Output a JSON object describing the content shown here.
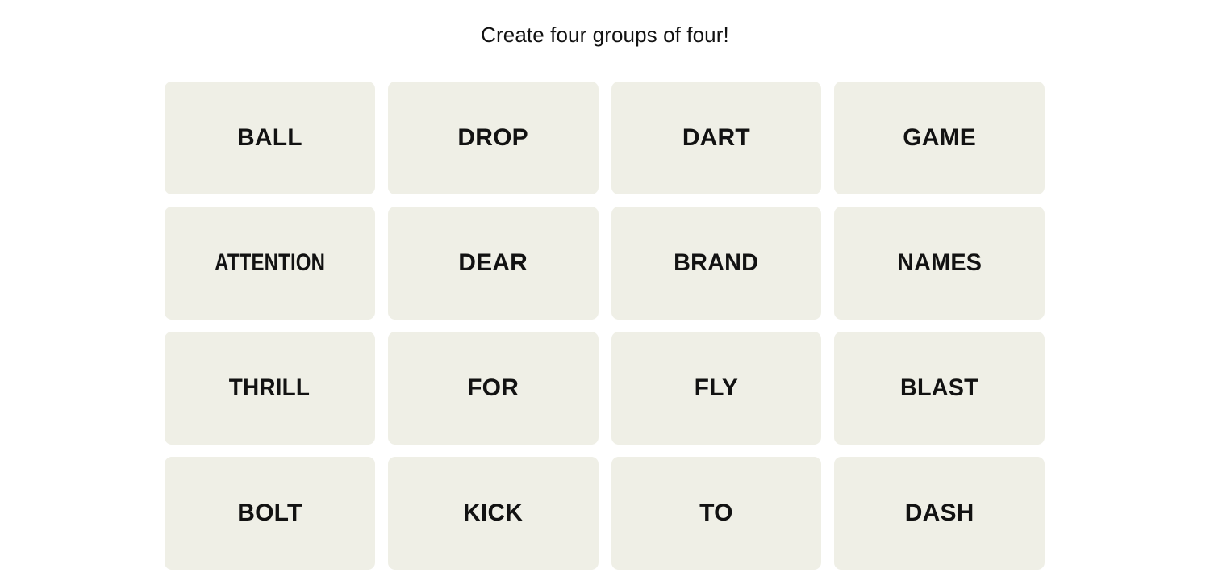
{
  "page": {
    "background_color": "#ffffff",
    "instruction": "Create four groups of four!"
  },
  "board": {
    "rows": 4,
    "columns": 4,
    "tile_background_color": "#efefe6",
    "tile_text_color": "#121212",
    "tiles": [
      {
        "label": "BALL"
      },
      {
        "label": "DROP"
      },
      {
        "label": "DART"
      },
      {
        "label": "GAME"
      },
      {
        "label": "ATTENTION"
      },
      {
        "label": "DEAR"
      },
      {
        "label": "BRAND"
      },
      {
        "label": "NAMES"
      },
      {
        "label": "THRILL"
      },
      {
        "label": "FOR"
      },
      {
        "label": "FLY"
      },
      {
        "label": "BLAST"
      },
      {
        "label": "BOLT"
      },
      {
        "label": "KICK"
      },
      {
        "label": "TO"
      },
      {
        "label": "DASH"
      }
    ]
  }
}
